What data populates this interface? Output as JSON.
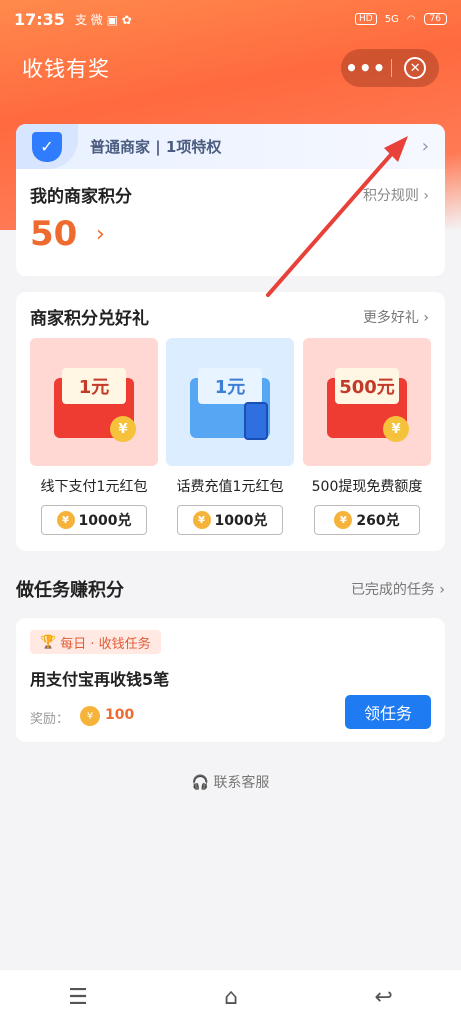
{
  "status": {
    "time": "17:35",
    "left_icons": "支 微 ▣ ✿",
    "hd": "HD",
    "signal": "5G",
    "battery": "76"
  },
  "header": {
    "title": "收钱有奖",
    "more": "•••",
    "close": "✕"
  },
  "merchant": {
    "level_text": "普通商家 | 1项特权",
    "points_title": "我的商家积分",
    "rules_link": "积分规则 ›",
    "points_value": "50",
    "points_arrow": "›",
    "chev": "›",
    "badge": "✓"
  },
  "gifts": {
    "title": "商家积分兑好礼",
    "more_link": "更多好礼 ›",
    "items": [
      {
        "label": "线下支付1元红包",
        "note": "1元",
        "price": "1000兑"
      },
      {
        "label": "话费充值1元红包",
        "note": "1元",
        "price": "1000兑"
      },
      {
        "label": "500提现免费额度",
        "note": "500元",
        "price": "260兑"
      }
    ]
  },
  "tasks": {
    "title": "做任务赚积分",
    "done_link": "已完成的任务 ›",
    "tag": "每日 · 收钱任务",
    "name": "用支付宝再收钱5笔",
    "reward_label": "奖励：",
    "reward_value": "100",
    "button": "领任务"
  },
  "support": {
    "text": "联系客服"
  },
  "navbar": {
    "menu": "☰",
    "home": "⌂",
    "back": "↩"
  },
  "colors": {
    "accent_orange": "#ef6a2f",
    "primary_blue": "#1f7bf2",
    "arrow_red": "#e8413a"
  }
}
